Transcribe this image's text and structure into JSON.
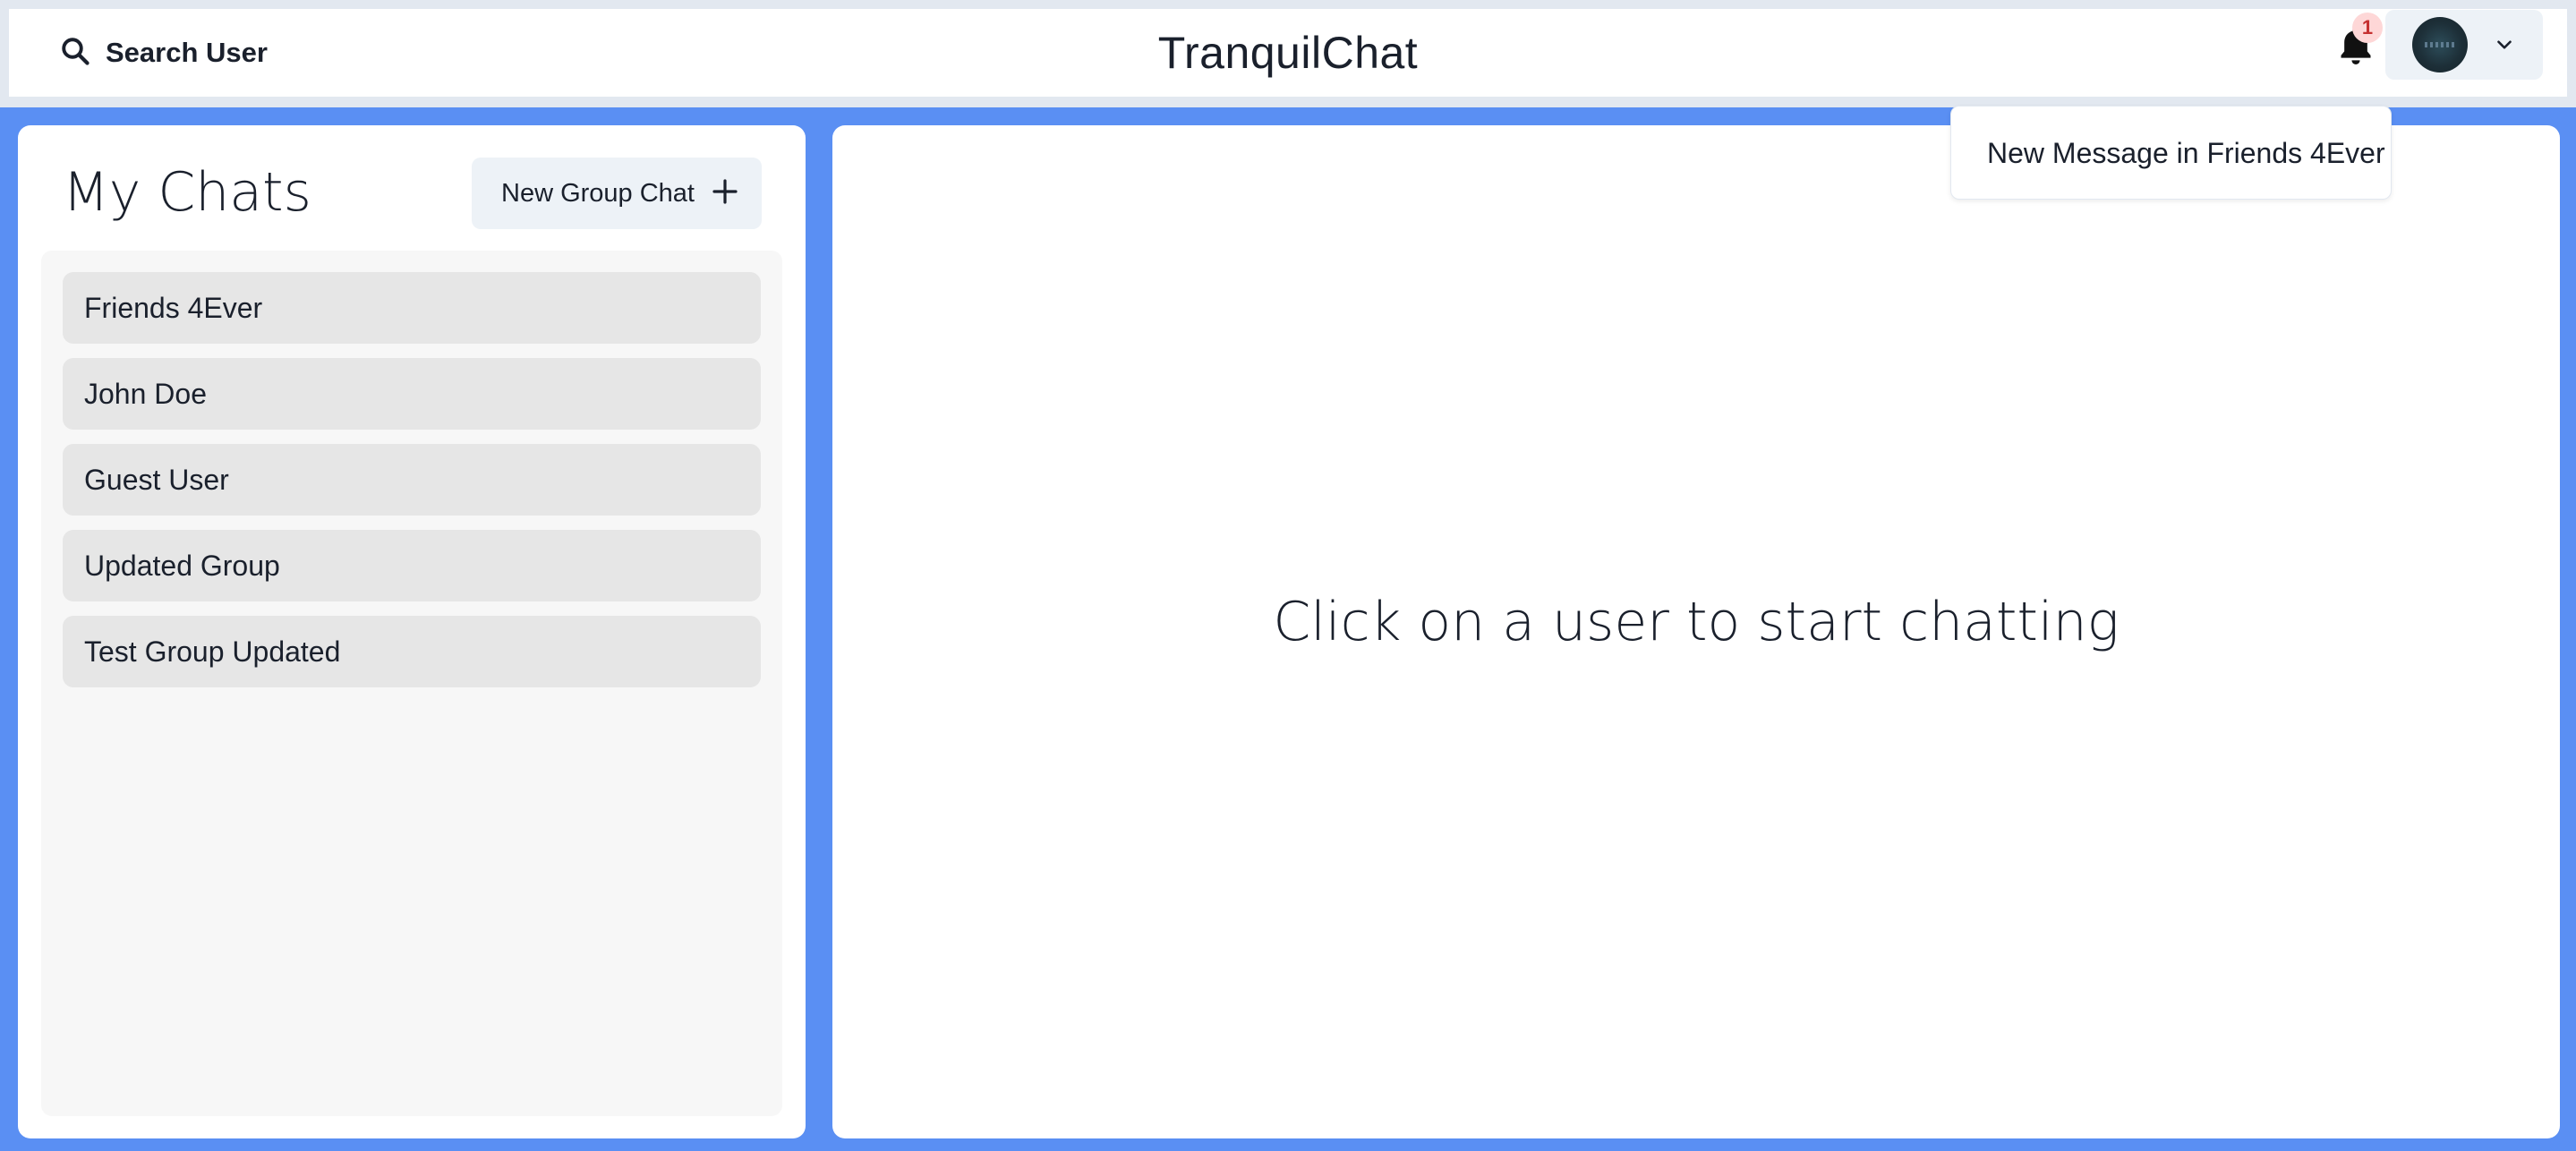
{
  "header": {
    "search_label": "Search User",
    "app_title": "TranquilChat",
    "notification_count": "1"
  },
  "sidebar": {
    "title": "My Chats",
    "new_group_label": "New Group Chat",
    "chats": [
      {
        "name": "Friends 4Ever"
      },
      {
        "name": "John Doe"
      },
      {
        "name": "Guest User"
      },
      {
        "name": "Updated Group"
      },
      {
        "name": "Test Group Updated"
      }
    ]
  },
  "main": {
    "empty_message": "Click on a user to start chatting"
  },
  "notifications": {
    "items": [
      {
        "text": "New Message in Friends 4Ever"
      }
    ]
  },
  "colors": {
    "accent_background": "#5a8ff3",
    "badge_bg": "#fed7d7",
    "badge_text": "#c53030"
  },
  "icons": [
    "search-icon",
    "bell-icon",
    "chevron-down-icon",
    "plus-icon"
  ]
}
